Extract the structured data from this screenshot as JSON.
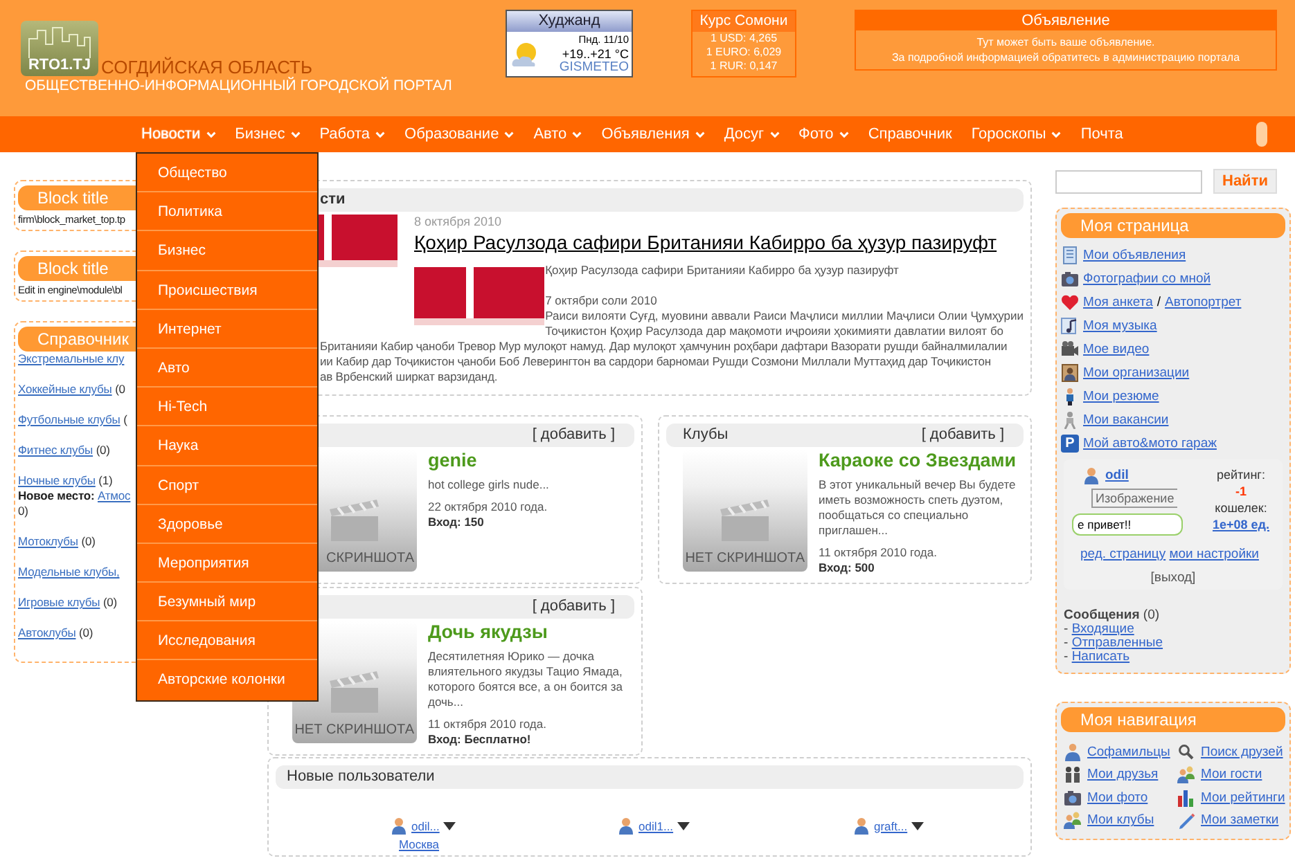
{
  "header": {
    "logo_text": "RTO1.TJ",
    "region": "СОГДИЙСКАЯ ОБЛАСТЬ",
    "subtitle": "ОБЩЕСТВЕННО-ИНФОРМАЦИОННЫЙ ГОРОДСКОЙ ПОРТАЛ"
  },
  "weather": {
    "city": "Худжанд",
    "date": "Пнд. 11/10",
    "temperature": "+19..+21 °C",
    "source": "GISMETEO"
  },
  "currency": {
    "title": "Курс Сомони",
    "rates": [
      "1 USD: 4,265",
      "1 EURO: 6,029",
      "1 RUR: 0,147"
    ]
  },
  "announcement": {
    "title": "Объявление",
    "lines": [
      "Тут может быть ваше объявление.",
      "За подробной информацией обратитесь в администрацию портала"
    ]
  },
  "nav": [
    {
      "label": "Новости",
      "dropdown": true,
      "expanded": true,
      "children": [
        "Общество",
        "Политика",
        "Бизнес",
        "Происшествия",
        "Интернет",
        "Авто",
        "Hi-Tech",
        "Наука",
        "Спорт",
        "Здоровье",
        "Мероприятия",
        "Безумный мир",
        "Исследования",
        "Авторские колонки"
      ]
    },
    {
      "label": "Бизнес",
      "dropdown": true,
      "expanded": false
    },
    {
      "label": "Работа",
      "dropdown": true,
      "expanded": false
    },
    {
      "label": "Образование",
      "dropdown": true,
      "expanded": false
    },
    {
      "label": "Авто",
      "dropdown": true,
      "expanded": false
    },
    {
      "label": "Объявления",
      "dropdown": true,
      "expanded": false
    },
    {
      "label": "Досуг",
      "dropdown": true,
      "expanded": false
    },
    {
      "label": "Фото",
      "dropdown": true,
      "expanded": false
    },
    {
      "label": "Справочник",
      "dropdown": false,
      "expanded": false
    },
    {
      "label": "Гороскопы",
      "dropdown": true,
      "expanded": false
    },
    {
      "label": "Почта",
      "dropdown": false,
      "expanded": false
    }
  ],
  "left_blocks": [
    {
      "kind": "text",
      "title": "Block title",
      "text": "firm\\block_market_top.tp"
    },
    {
      "kind": "text",
      "title": "Block title",
      "text": "Edit in engine\\module\\bl"
    },
    {
      "kind": "directory",
      "title": "Справочник",
      "entries": [
        {
          "link": "Экстремальные клу"
        },
        {
          "link": "Хоккейные клубы",
          "count": "(0"
        },
        {
          "link": "Футбольные клубы",
          "count": "("
        },
        {
          "link": "Фитнес клубы",
          "count": "(0)"
        },
        {
          "link": "Ночные клубы",
          "count": "(1)",
          "new_place": {
            "label": "Новое место:",
            "link": "Атмос",
            "tail": "0)"
          }
        },
        {
          "link": "Мотоклубы",
          "count": "(0)"
        },
        {
          "link": "Модельные клубы,"
        },
        {
          "link": "Игровые клубы",
          "count": "(0)"
        },
        {
          "link": "Автоклубы",
          "count": "(0)"
        }
      ]
    }
  ],
  "news": {
    "title": "сти",
    "article": {
      "date": "8 октября 2010",
      "headline": "Қоҳир Расулзода сафири Британияи Кабирро ба ҳузур пазируфт",
      "lead": "Қоҳир Расулзода сафири Британияи Кабирро ба ҳузур пазируфт",
      "date2": "7 октябри соли 2010",
      "lines_beside_image": [
        "Раиси вилояти Суғд, муовини аввали Раиси Маҷлиси миллии Маҷлиси Олии Ҷумҳурии",
        "Тоҷикистон Қоҳир Расулзода дар мақомоти иҷроияи ҳокимияти давлатии вилоят бо"
      ],
      "lines_below": [
        "Британияи Кабир ҷаноби Тревор Мур мулоқот намуд. Дар мулоқот ҳамчунин роҳбари дафтари Вазорати рушди байналмилалии",
        "ии Кабир дар Тоҷикистон  ҷаноби Боб Леверингтон ва сардори барномаи Рушди Созмони Миллали Муттаҳид дар Тоҷикистон",
        "ав Врбенский ширкат варзиданд."
      ]
    }
  },
  "events": [
    {
      "add": "[ добавить ]",
      "caption": "СКРИНШОТА",
      "name": "genie",
      "description": "hot college girls nude...",
      "date": "22 октября 2010 года.",
      "price": "Вход: 150"
    },
    {
      "title": "Клубы",
      "add": "[ добавить ]",
      "caption": "НЕТ СКРИНШОТА",
      "name": "Караоке со Звездами",
      "description": "В этот уникальный вечер Вы будете иметь возможность спеть дуэтом, пообщаться со специально приглашен...",
      "date": "11 октября 2010 года.",
      "price": "Вход: 500"
    },
    {
      "add": "[ добавить ]",
      "caption": "НЕТ СКРИНШОТА",
      "name": "Дочь якудзы",
      "description": "Десятилетняя Юрико — дочка влиятельного якудзы Тацио Ямада, которого боятся все, а он боится за дочь...",
      "date": "11 октября 2010 года.",
      "price": "Вход: Бесплатно!"
    }
  ],
  "new_users": {
    "title": "Новые пользователи",
    "users": [
      {
        "name": "odil...",
        "city": "Москва"
      },
      {
        "name": "odil1..."
      },
      {
        "name": "graft..."
      }
    ]
  },
  "search": {
    "button": "Найти"
  },
  "my_page": {
    "title": "Моя страница",
    "links": [
      {
        "kind": "ads",
        "label": "Мои объявления"
      },
      {
        "kind": "photo",
        "label": "Фотографии со мной"
      },
      {
        "kind": "heart",
        "label": "Моя анкета",
        "separator": "/",
        "extra": "Автопортрет"
      },
      {
        "kind": "music",
        "label": "Моя музыка"
      },
      {
        "kind": "video",
        "label": "Мое видео"
      },
      {
        "kind": "org",
        "label": "Мои организации"
      },
      {
        "kind": "resume",
        "label": "Мои резюме"
      },
      {
        "kind": "vacancy",
        "label": "Мои вакансии"
      },
      {
        "kind": "parking",
        "label": "Мой авто&мото гараж",
        "icon_text": "P"
      }
    ],
    "profile": {
      "user": "odil",
      "image_alt": "Изображение",
      "status": "е привет!!",
      "rating_label": "рейтинг:",
      "rating": "-1",
      "wallet_label": "кошелек:",
      "wallet": "1е+08 ед.",
      "links": [
        "ред. страницу",
        "мои настройки"
      ],
      "logout": "[выход]"
    },
    "messages": {
      "title": "**Сообщения** (0)",
      "links": [
        {
          "bullet": "-",
          "label": "Входящие"
        },
        {
          "bullet": "-",
          "label": "Отправленные"
        },
        {
          "bullet": "-",
          "label": "Написать"
        }
      ]
    }
  },
  "my_nav": {
    "title": "Моя навигация",
    "links": [
      {
        "kind": "family",
        "label": "Софамильцы"
      },
      {
        "kind": "search",
        "label": "Поиск друзей"
      },
      {
        "kind": "friends",
        "label": "Мои друзья"
      },
      {
        "kind": "guests",
        "label": "Мои гости"
      },
      {
        "kind": "photo",
        "label": "Мои фото"
      },
      {
        "kind": "ratings",
        "label": "Мои рейтинги"
      },
      {
        "kind": "clubs",
        "label": "Мои клубы"
      },
      {
        "kind": "notes",
        "label": "Мои заметки"
      }
    ]
  }
}
